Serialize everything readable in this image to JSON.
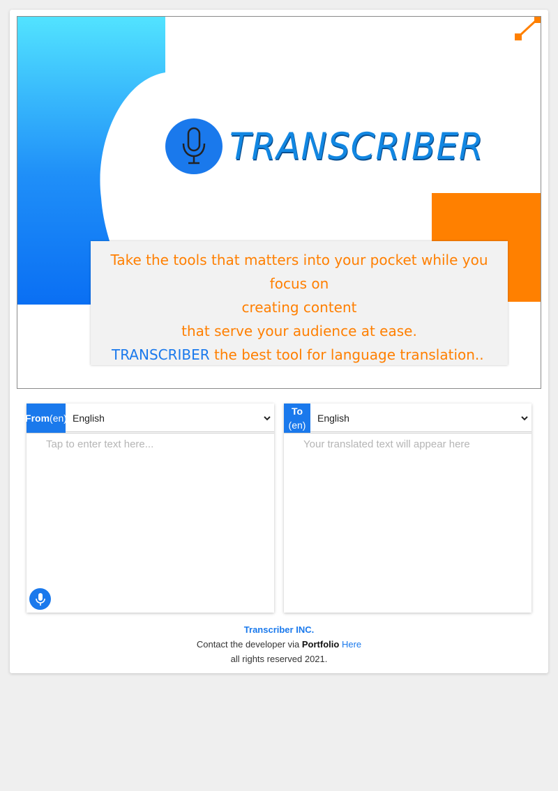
{
  "hero": {
    "logo_text": "TRANSCRIBER",
    "tagline": {
      "line1": "Take the tools that matters into your pocket while you focus on",
      "line2": "creating content",
      "line3": "that serve your audience at ease.",
      "brand": "TRANSCRIBER",
      "line4_rest": " the best tool for language translation.."
    }
  },
  "translator": {
    "from": {
      "label": "From",
      "code": "(en)",
      "selected": "English",
      "placeholder": "Tap to enter text here..."
    },
    "to": {
      "label": "To",
      "code": "(en)",
      "selected": "English",
      "placeholder": "Your translated text will appear here"
    }
  },
  "footer": {
    "company": "Transcriber INC.",
    "contact_prefix": "Contact the developer via ",
    "portfolio": "Portfolio",
    "link": "Here",
    "rights": "all rights reserved 2021."
  },
  "colors": {
    "accent": "#1a79ec",
    "orange": "#ff7f00",
    "cyan": "#4fdcff"
  },
  "icons": [
    "microphone-icon",
    "expand-arrow-icon",
    "chevron-down-icon"
  ]
}
